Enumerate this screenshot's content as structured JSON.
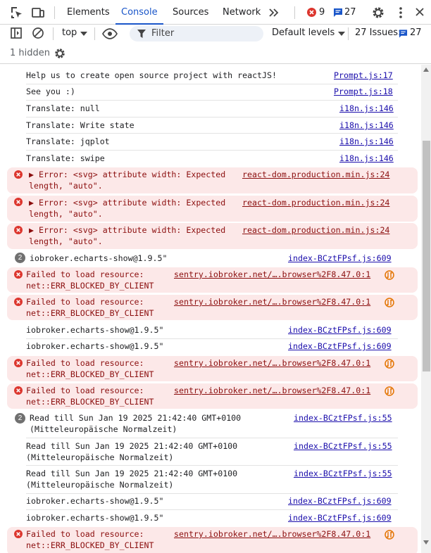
{
  "tabs": [
    "Elements",
    "Console",
    "Sources",
    "Network"
  ],
  "counters": {
    "errors": "9",
    "messages": "27"
  },
  "toolbar": {
    "context": "top",
    "filter_placeholder": "Filter",
    "levels": "Default levels",
    "issues_label": "27 Issues:",
    "issues_count": "27"
  },
  "hidden_label": "1 hidden",
  "messages": [
    {
      "text": "Help us to create open source project with reactJS!",
      "source": "Prompt.js:17"
    },
    {
      "text": "See you :)",
      "source": "Prompt.js:18"
    },
    {
      "text": "Translate: null",
      "source": "i18n.js:146"
    },
    {
      "text": "Translate: Write state",
      "source": "i18n.js:146"
    },
    {
      "text": "Translate: jqplot",
      "source": "i18n.js:146"
    },
    {
      "text": "Translate: swipe",
      "source": "i18n.js:146"
    },
    {
      "text": "▶ Error: <svg> attribute width: Expected\nlength, \"auto\".",
      "source": "react-dom.production.min.js:24"
    },
    {
      "text": "▶ Error: <svg> attribute width: Expected\nlength, \"auto\".",
      "source": "react-dom.production.min.js:24"
    },
    {
      "text": "▶ Error: <svg> attribute width: Expected\nlength, \"auto\".",
      "source": "react-dom.production.min.js:24"
    },
    {
      "repeat": "2",
      "text": "iobroker.echarts-show@1.9.5\"",
      "source": "index-BCztFPsf.js:609"
    },
    {
      "text": "Failed to load resource:\nnet::ERR_BLOCKED_BY_CLIENT",
      "source": "sentry.iobroker.net/….browser%2F8.47.0:1"
    },
    {
      "text": "Failed to load resource:\nnet::ERR_BLOCKED_BY_CLIENT",
      "source": "sentry.iobroker.net/….browser%2F8.47.0:1"
    },
    {
      "text": "iobroker.echarts-show@1.9.5\"",
      "source": "index-BCztFPsf.js:609"
    },
    {
      "text": "iobroker.echarts-show@1.9.5\"",
      "source": "index-BCztFPsf.js:609"
    },
    {
      "text": "Failed to load resource:\nnet::ERR_BLOCKED_BY_CLIENT",
      "source": "sentry.iobroker.net/….browser%2F8.47.0:1"
    },
    {
      "text": "Failed to load resource:\nnet::ERR_BLOCKED_BY_CLIENT",
      "source": "sentry.iobroker.net/….browser%2F8.47.0:1"
    },
    {
      "repeat": "2",
      "text": "Read till Sun Jan 19 2025 21:42:40 GMT+0100\n(Mitteleuropäische Normalzeit)",
      "source": "index-BCztFPsf.js:55"
    },
    {
      "text": "Read till Sun Jan 19 2025 21:42:40 GMT+0100\n(Mitteleuropäische Normalzeit)",
      "source": "index-BCztFPsf.js:55"
    },
    {
      "text": "Read till Sun Jan 19 2025 21:42:40 GMT+0100\n(Mitteleuropäische Normalzeit)",
      "source": "index-BCztFPsf.js:55"
    },
    {
      "text": "iobroker.echarts-show@1.9.5\"",
      "source": "index-BCztFPsf.js:609"
    },
    {
      "text": "iobroker.echarts-show@1.9.5\"",
      "source": "index-BCztFPsf.js:609"
    },
    {
      "text": "Failed to load resource:\nnet::ERR_BLOCKED_BY_CLIENT",
      "source": "sentry.iobroker.net/….browser%2F8.47.0:1"
    }
  ]
}
